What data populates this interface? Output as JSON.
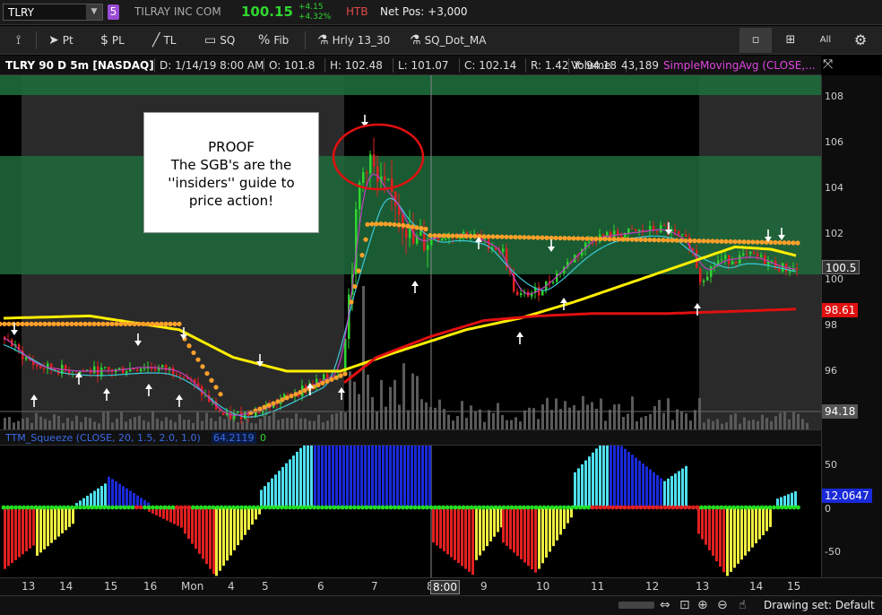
{
  "header": {
    "symbol": "TLRY",
    "link_badge": "5",
    "company": "TILRAY INC COM",
    "last": "100.15",
    "change_abs": "+4.15",
    "change_pct": "+4.32%",
    "htb": "HTB",
    "net_pos": "Net Pos: +3,000"
  },
  "toolbar": {
    "pin": "",
    "pt": "Pt",
    "pl": "PL",
    "tl": "TL",
    "sq": "SQ",
    "fib": "Fib",
    "study1": "Hrly 13_30",
    "study2": "SQ_Dot_MA",
    "all": "All"
  },
  "info": {
    "title": "TLRY 90 D 5m [NASDAQ]",
    "date": "D: 1/14/19 8:00 AM",
    "open": "O: 101.8",
    "high": "H: 102.48",
    "low": "L: 101.07",
    "close": "C: 102.14",
    "range": "R: 1.42",
    "y": "Y: 94.18",
    "volume_label": "Volume",
    "volume": "43,189",
    "study": "SimpleMovingAvg (CLOSE,..."
  },
  "note": {
    "line1": "PROOF",
    "line2": "The SGB's are the",
    "line3": "''insiders'' guide to",
    "line4": "price action!"
  },
  "price_axis": {
    "ticks": [
      "108",
      "106",
      "104",
      "102",
      "100",
      "98",
      "96"
    ],
    "tag_last": "100.5",
    "tag_ma": "98.61",
    "tag_cursor": "94.18"
  },
  "squeeze": {
    "label": "TTM_Squeeze (CLOSE, 20, 1.5, 2.0, 1.0)",
    "value": "64.2119",
    "alert": "0",
    "ticks": [
      "50",
      "0",
      "-50"
    ],
    "tag": "12.0647"
  },
  "x_axis": {
    "labels": [
      "13",
      "14",
      "15",
      "16",
      "Mon",
      "4",
      "5",
      "6",
      "7",
      "8",
      "8:00",
      "9",
      "10",
      "11",
      "12",
      "13",
      "14",
      "15"
    ]
  },
  "status": {
    "drawing_set": "Drawing set: Default"
  },
  "colors": {
    "green_zone": "#1e6b3c",
    "sma_yellow": "#ffee00",
    "sma_red": "#e01010",
    "dots_orange": "#ffa02a",
    "cyan": "#3ec8d8",
    "magenta": "#c040c0",
    "hist_cyan": "#4fe0f0",
    "hist_blue": "#1a2ad8",
    "hist_red": "#e02020",
    "hist_yellow": "#eeee40"
  }
}
